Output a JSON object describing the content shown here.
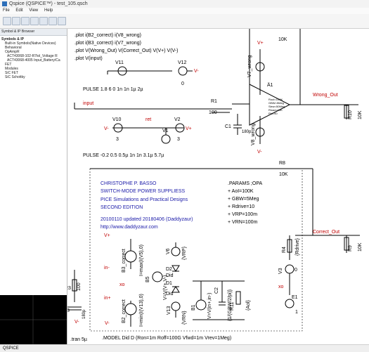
{
  "window": {
    "title": "Qspice (QSPICE™) - test_105.qsch"
  },
  "menu": [
    "File",
    "Edit",
    "View",
    "Help"
  ],
  "sidebar": {
    "header": "Symbol & IP Browser",
    "items": [
      "Symbols & IP",
      "Built-in Symbols(Native Devices)",
      "Behavioral",
      "OpAmpR",
      "ACT43068-102-R7tol_Voltage R",
      "ACT43068-4005 Input_Battery/Ca",
      "FET",
      "Modules",
      "SiC FET",
      "SiC Schottky"
    ]
  },
  "schematic": {
    "directives": [
      ".plot i(B2_correct) i(V8_wrong)",
      ".plot i(B3_correct) i(V7_wrong)",
      ".plot V(Wrong_Out) V(Correct_Out) V(V+) V(V-)",
      ".plot V(input)"
    ],
    "pulse1": "PULSE 1.8 6 0 1n 1n 1µ 2µ",
    "pulse2": "PULSE -0.2 0.5 0.5µ 1n 1n 3.1µ 5.7µ",
    "labels": {
      "v11": "V11",
      "v12": "V12",
      "v12_val": "0",
      "v11_val": "V+",
      "v12_vminus": "V-",
      "v10": "V10",
      "v10_val": "3",
      "v2": "V2",
      "v2_val": "3",
      "v1": "V1",
      "ret": "ret",
      "input": "input",
      "r1": "R1",
      "r1_val": "100",
      "c1": "C1",
      "c1_val": "180p",
      "r6": "R6",
      "r6_val": "10K",
      "u1": "Ä1",
      "v7": "V7_wrong",
      "v8": "V8_wrong",
      "wrong_out": "Wrong_Out",
      "r10": "R10",
      "r10_val": "10K",
      "r8": "R8",
      "r8_val": "10K",
      "correct_out": "Correct_Out",
      "r9": "R9",
      "r9_val": "10K",
      "r4": "R4",
      "r4_val": "{Rdrive}",
      "v3": "V3",
      "v3_val": "0",
      "e1": "E1",
      "e1_val": "1",
      "r3": "R3",
      "r3_val": "100",
      "c3": "C3",
      "c3_val": "180p",
      "b3": "B3_correct",
      "b3_expr": "I=max(I(V5),0)",
      "b2": "B2_correct",
      "b2_expr": "I=min(I(V13),0)",
      "v6": "V6",
      "v6_val": "{VRP}",
      "d2": "D2",
      "d2_val": "Did",
      "d1": "D1",
      "d1_val": "Did",
      "v13": "V13",
      "v13_val": "{VRN}",
      "b5": "B5",
      "b5_expr": "V=V(V+,V-)",
      "b1": "B1",
      "b1_expr": "V=V(in+,in-)",
      "c2": "C2",
      "c2_expr": "{1/(GBW/2/pi)}",
      "r11": "R11",
      "r11_val": "{Aol}",
      "vp": "V+",
      "vm": "V-",
      "inm": "in-",
      "inp": "in+",
      "xo": "xo",
      "xo2": "xo"
    },
    "opamp_text": [
      "Rout=100K",
      "GBW=5Meg",
      "Slew=50Meg",
      "Rload=10K",
      "Phi=90"
    ],
    "textbox": [
      "CHRISTOPHE P. BASSO",
      "SWITCH-MODE POWER SUPPLIESS",
      "PICE Simulations and Practical Designs",
      "SECOND EDITION",
      "20100110 updated 20180406 (Daddyzaur)",
      "http://www.daddyzaur.com"
    ],
    "params": [
      ".PARAMS ;OPA",
      "+ AoI=100K",
      "+ GBW=5Meg",
      "+ Rdrive=10",
      "+ VRP=100m",
      "+ VRN=100m"
    ],
    "model": ".MODEL Did D (Ron=1m Roff=100G Vfwd=1m Vrev=1Meg)",
    "tran": ".tran 5µ"
  },
  "status": "QSPICE"
}
